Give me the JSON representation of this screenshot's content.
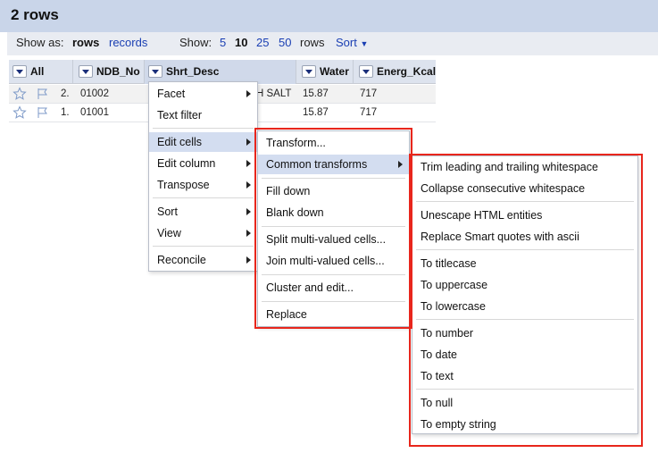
{
  "header": {
    "title": "2 rows"
  },
  "view_bar": {
    "show_as_label": "Show as:",
    "rows_label": "rows",
    "records_label": "records",
    "show_label": "Show:",
    "page_sizes": [
      "5",
      "10",
      "25",
      "50"
    ],
    "page_size_suffix": "rows",
    "sort_label": "Sort"
  },
  "table": {
    "columns": [
      "All",
      "NDB_No",
      "Shrt_Desc",
      "Water",
      "Energ_Kcal"
    ],
    "rows": [
      {
        "index": "2.",
        "ndb_no": "01002",
        "shrt_desc": "H SALT",
        "water": "15.87",
        "energ_kcal": "717"
      },
      {
        "index": "1.",
        "ndb_no": "01001",
        "shrt_desc": "",
        "water": "15.87",
        "energ_kcal": "717"
      }
    ]
  },
  "column_menu": {
    "items": [
      "Facet",
      "Text filter",
      "Edit cells",
      "Edit column",
      "Transpose",
      "Sort",
      "View",
      "Reconcile"
    ]
  },
  "edit_cells_menu": {
    "items": [
      "Transform...",
      "Common transforms",
      "Fill down",
      "Blank down",
      "Split multi-valued cells...",
      "Join multi-valued cells...",
      "Cluster and edit...",
      "Replace"
    ]
  },
  "common_transforms_menu": {
    "items": [
      "Trim leading and trailing whitespace",
      "Collapse consecutive whitespace",
      "Unescape HTML entities",
      "Replace Smart quotes with ascii",
      "To titlecase",
      "To uppercase",
      "To lowercase",
      "To number",
      "To date",
      "To text",
      "To null",
      "To empty string"
    ]
  },
  "colors": {
    "header_bg": "#c9d5e9",
    "highlight": "#d3ddf0",
    "link": "#1a3fb3",
    "callout": "#e8261c"
  }
}
